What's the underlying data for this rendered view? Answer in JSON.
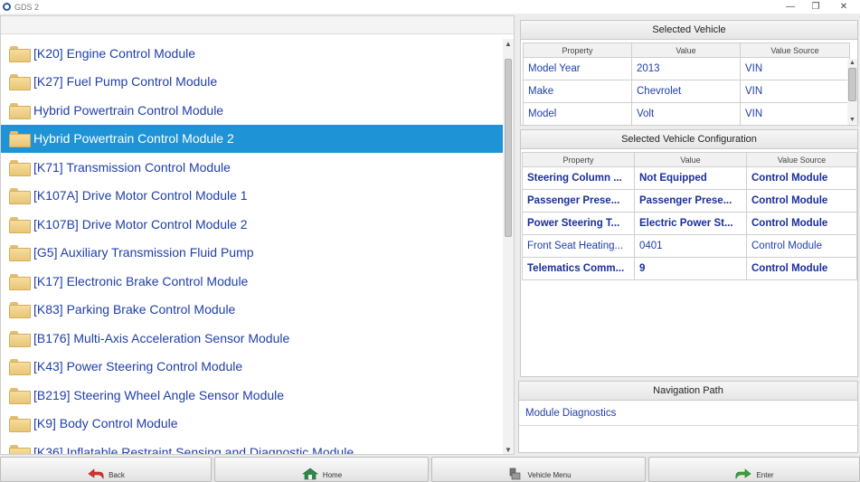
{
  "window": {
    "title": "GDS 2"
  },
  "modules": [
    {
      "label": "[K20] Engine Control Module",
      "selected": false
    },
    {
      "label": "[K27] Fuel Pump Control Module",
      "selected": false
    },
    {
      "label": "Hybrid Powertrain Control Module",
      "selected": false
    },
    {
      "label": "Hybrid Powertrain Control Module 2",
      "selected": true
    },
    {
      "label": "[K71] Transmission Control Module",
      "selected": false
    },
    {
      "label": "[K107A] Drive Motor Control Module 1",
      "selected": false
    },
    {
      "label": "[K107B] Drive Motor Control Module 2",
      "selected": false
    },
    {
      "label": "[G5] Auxiliary Transmission Fluid Pump",
      "selected": false
    },
    {
      "label": "[K17] Electronic Brake Control Module",
      "selected": false
    },
    {
      "label": "[K83] Parking Brake Control Module",
      "selected": false
    },
    {
      "label": "[B176] Multi-Axis Acceleration Sensor Module",
      "selected": false
    },
    {
      "label": "[K43] Power Steering Control Module",
      "selected": false
    },
    {
      "label": "[B219] Steering Wheel Angle Sensor Module",
      "selected": false
    },
    {
      "label": "[K9] Body Control Module",
      "selected": false
    },
    {
      "label": "[K36] Inflatable Restraint Sensing and Diagnostic Module",
      "selected": false
    }
  ],
  "selected_vehicle": {
    "title": "Selected Vehicle",
    "headers": [
      "Property",
      "Value",
      "Value Source"
    ],
    "rows": [
      [
        "Model Year",
        "2013",
        "VIN"
      ],
      [
        "Make",
        "Chevrolet",
        "VIN"
      ],
      [
        "Model",
        "Volt",
        "VIN"
      ]
    ]
  },
  "vehicle_config": {
    "title": "Selected Vehicle Configuration",
    "headers": [
      "Property",
      "Value",
      "Value Source"
    ],
    "rows": [
      {
        "cells": [
          "Steering Column ...",
          "Not Equipped",
          "Control Module"
        ],
        "bold": true
      },
      {
        "cells": [
          "Passenger Prese...",
          "Passenger Prese...",
          "Control Module"
        ],
        "bold": true
      },
      {
        "cells": [
          "Power Steering T...",
          "Electric Power St...",
          "Control Module"
        ],
        "bold": true
      },
      {
        "cells": [
          "Front Seat Heating...",
          "0401",
          "Control Module"
        ],
        "bold": false
      },
      {
        "cells": [
          "Telematics Comm...",
          "9",
          "Control Module"
        ],
        "bold": true
      }
    ]
  },
  "navigation_path": {
    "title": "Navigation Path",
    "items": [
      "Module Diagnostics"
    ]
  },
  "toolbar": {
    "buttons": [
      {
        "label": "Back",
        "icon": "back-arrow-icon",
        "color": "#d9342b"
      },
      {
        "label": "Home",
        "icon": "home-icon",
        "color": "#2e8a4a"
      },
      {
        "label": "Vehicle Menu",
        "icon": "vehicle-menu-icon",
        "color": "#555555"
      },
      {
        "label": "Enter",
        "icon": "enter-arrow-icon",
        "color": "#3aa33a"
      }
    ]
  },
  "colors": {
    "selection": "#1e93d6",
    "link_text": "#1f3fa8"
  }
}
